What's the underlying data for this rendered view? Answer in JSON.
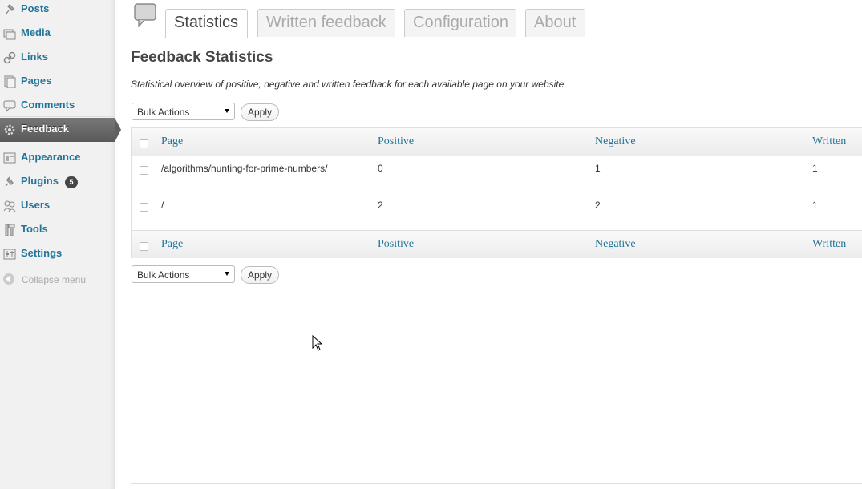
{
  "sidebar": {
    "items": [
      {
        "label": "Posts",
        "icon": "pushpin-icon"
      },
      {
        "label": "Media",
        "icon": "media-icon"
      },
      {
        "label": "Links",
        "icon": "link-icon"
      },
      {
        "label": "Pages",
        "icon": "pages-icon"
      },
      {
        "label": "Comments",
        "icon": "comment-icon"
      },
      {
        "label": "Feedback",
        "icon": "gear-icon",
        "active": true
      },
      {
        "label": "Appearance",
        "icon": "appearance-icon"
      },
      {
        "label": "Plugins",
        "icon": "plug-icon",
        "badge": "5"
      },
      {
        "label": "Users",
        "icon": "users-icon"
      },
      {
        "label": "Tools",
        "icon": "tools-icon"
      },
      {
        "label": "Settings",
        "icon": "settings-icon"
      }
    ],
    "collapse_label": "Collapse menu"
  },
  "tabs": [
    {
      "label": "Statistics",
      "active": true
    },
    {
      "label": "Written feedback"
    },
    {
      "label": "Configuration"
    },
    {
      "label": "About"
    }
  ],
  "header": {
    "title": "Feedback Statistics",
    "description": "Statistical overview of positive, negative and written feedback for each available page on your website."
  },
  "bulk": {
    "select_value": "Bulk Actions",
    "apply_label": "Apply"
  },
  "table": {
    "columns": [
      "Page",
      "Positive",
      "Negative",
      "Written"
    ],
    "rows": [
      [
        "/algorithms/hunting-for-prime-numbers/",
        "0",
        "1",
        "1"
      ],
      [
        "/",
        "2",
        "2",
        "1"
      ]
    ]
  },
  "colors": {
    "link": "#21759b",
    "active_menu": "#5f5f5f"
  }
}
